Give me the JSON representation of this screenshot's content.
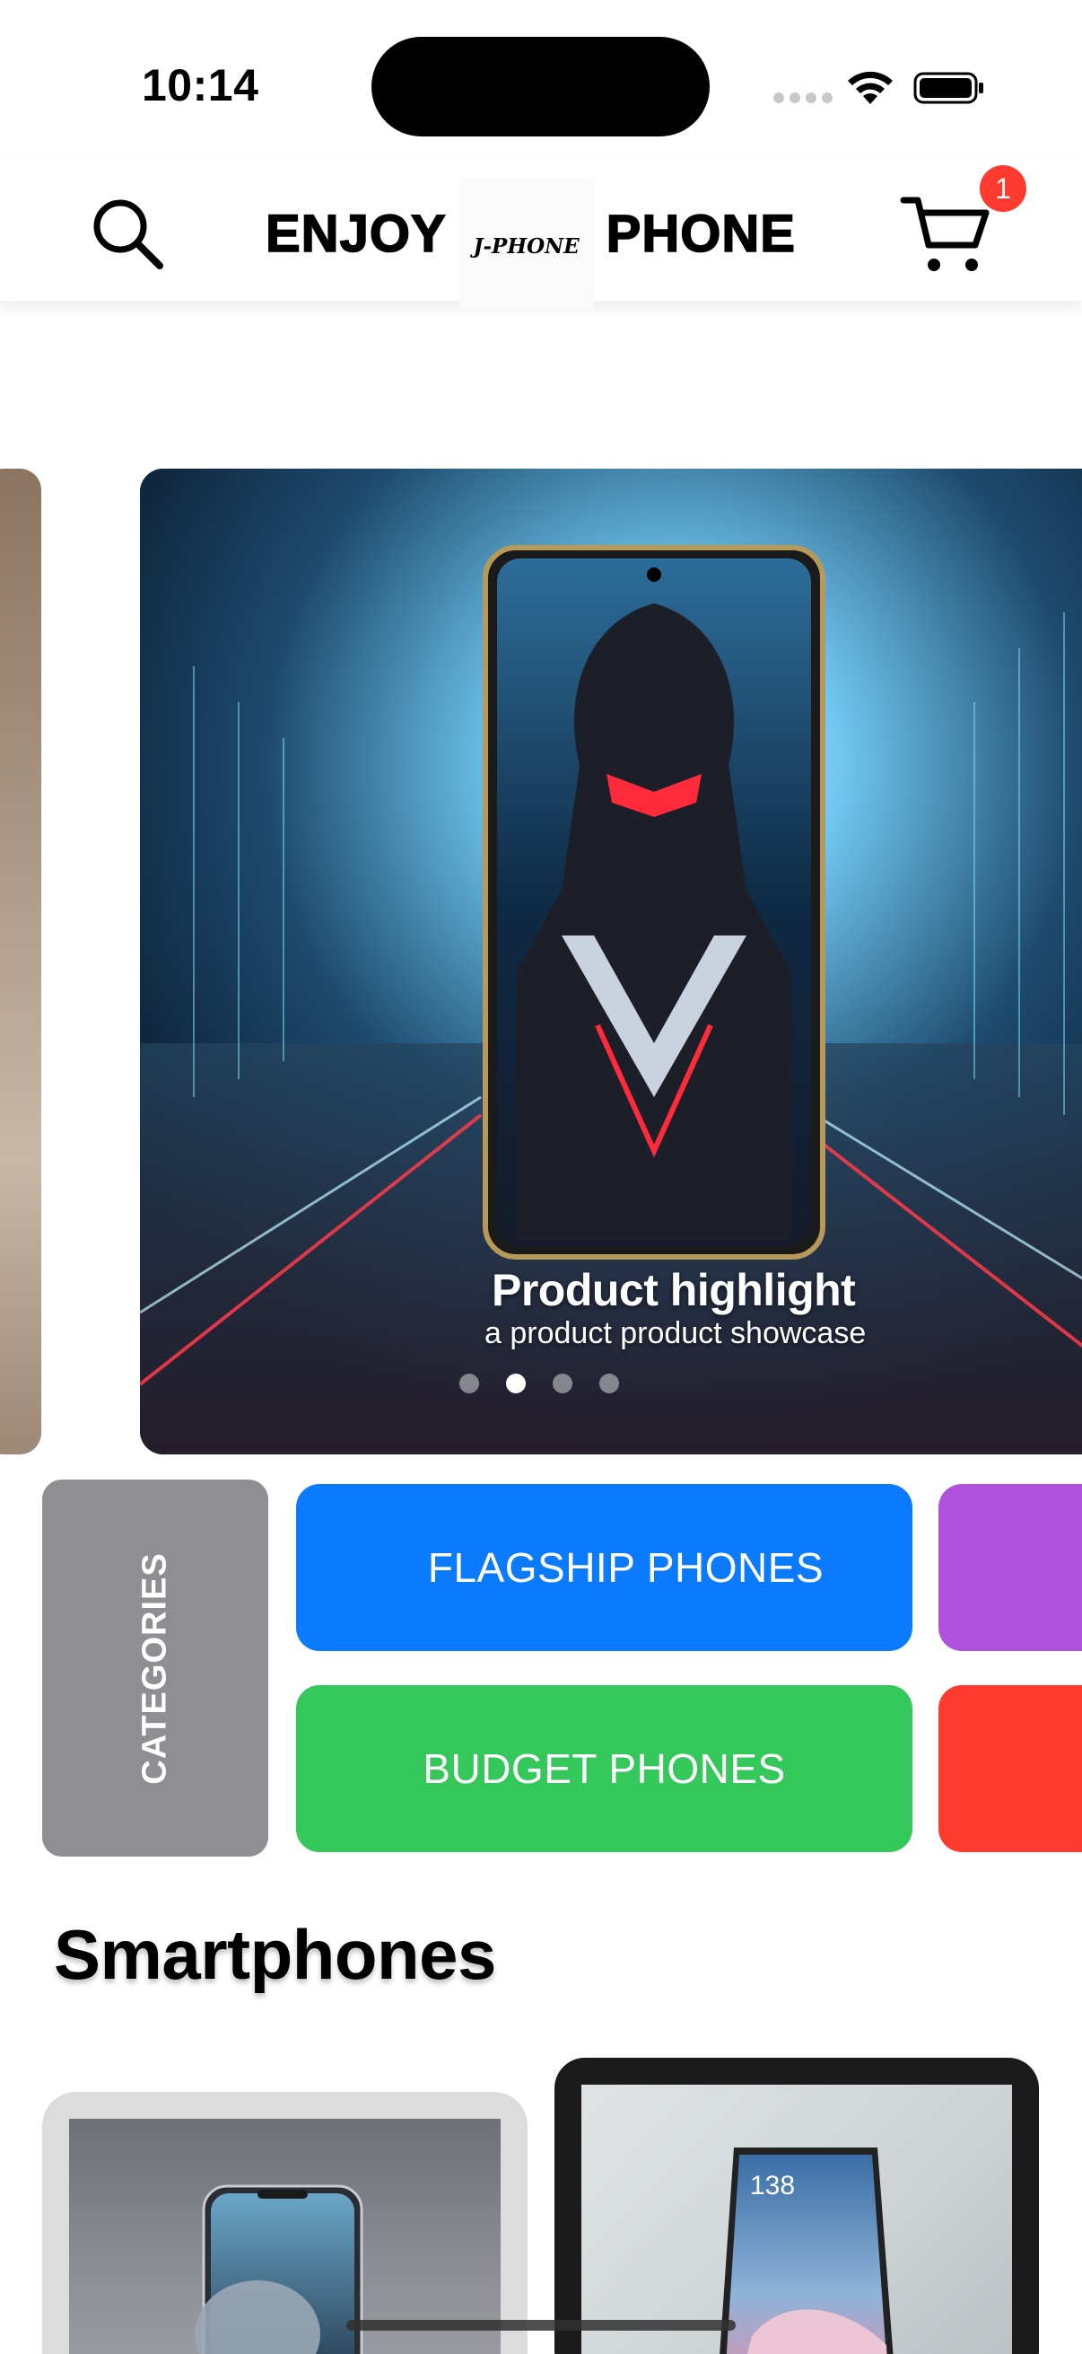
{
  "status_bar": {
    "time": "10:14"
  },
  "header": {
    "brand_left": "ENJOY",
    "brand_logo": "J-PHONE",
    "brand_right": "PHONE",
    "cart_count": "1",
    "icons": [
      "search-icon",
      "cart-icon"
    ]
  },
  "carousel": {
    "title": "Product highlight",
    "subtitle": "a product product showcase",
    "page_count": 4,
    "active_index": 1
  },
  "categories": {
    "label": "CATEGORIES",
    "items": [
      {
        "label": "FLAGSHIP PHONES",
        "color": "#0a7aff"
      },
      {
        "label": "BUDGET PHONES",
        "color": "#34c759"
      },
      {
        "label": "",
        "color": "#af52de"
      },
      {
        "label": "",
        "color": "#ff3b30"
      }
    ]
  },
  "smartphones": {
    "title": "Smartphones",
    "products": [
      {
        "name": "product-card-1"
      },
      {
        "name": "product-card-2",
        "screen_time": "138"
      }
    ]
  }
}
